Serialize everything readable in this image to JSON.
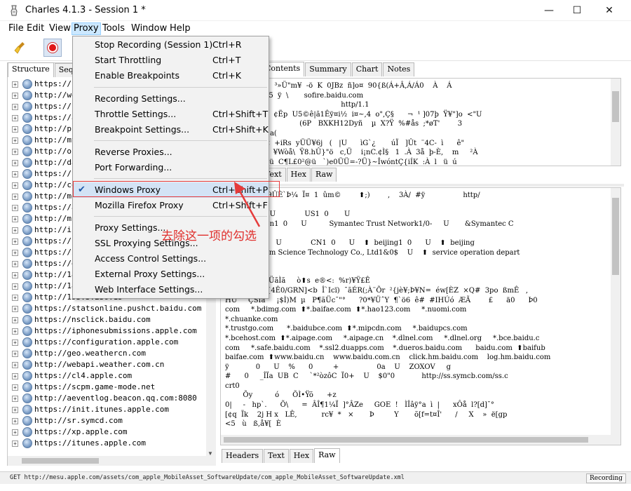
{
  "window": {
    "title": "Charles 4.1.3 - Session 1 *",
    "minimize_glyph": "—",
    "maximize_glyph": "☐",
    "close_glyph": "✕"
  },
  "menubar": [
    "File",
    "Edit",
    "View",
    "Proxy",
    "Tools",
    "Window",
    "Help"
  ],
  "toolbar": {
    "icons": [
      "broom-icon",
      "record-icon"
    ]
  },
  "left_panel": {
    "tabs": [
      "Structure",
      "Seq"
    ],
    "hosts": [
      "https://s",
      "http://we",
      "https://u",
      "https://a",
      "http://pu",
      "http://mt",
      "http://on",
      "http://da",
      "https://s",
      "http://co",
      "http://mo",
      "https://a",
      "http://m.",
      "http://if",
      "https://c",
      "https://i",
      "https://g",
      "http://18",
      "http://185.map.baidu.com",
      "http://153.3.236.15",
      "https://statsonline.pushct.baidu.com",
      "https://nsclick.baidu.com",
      "https://iphonesubmissions.apple.com",
      "https://configuration.apple.com",
      "http://geo.weathercn.com",
      "http://webapi.weather.com.cn",
      "https://cl4.apple.com",
      "https://scpm.game-mode.net",
      "http://aeventlog.beacon.qq.com:8080",
      "https://init.itunes.apple.com",
      "http://sr.symcd.com",
      "https://xp.apple.com",
      "https://itunes.apple.com"
    ]
  },
  "right_panel": {
    "top_tabs": [
      "Contents",
      "Summary",
      "Chart",
      "Notes"
    ],
    "top_subtabs": [
      "Text",
      "Hex",
      "Raw"
    ],
    "top_lines": [
      "  ±   -    yz¤    ³»Ü\"m¥  -ö  K  0JBz  ñ]o¤  90{ß(Á+Â,Á/Á0    À    Á",
      "  39Â  À      /5  ÿ  \\       sofire.baidu.com",
      "                                                    http/1.1",
      "        F  BA     ¢Ëp  U5©ê|ã1Êÿ¤i½  i¤~,4  o\",Ç§      ¬  ¹ ]07þ  Ÿ¥\"]o  <\"U",
      "ü0ÜA0Ï I:                  (6P   BXKH12Dyñ    µ  X?Ÿ  %#ås  ;*øT'        3",
      "    R0    AtÂ2a(",
      "N   o   Â%jÏ¤  +iRs  yÜÜ¥6j   (   |U      ìG`¿       úÏ   ]Ût  ¨4C-  ì      ê\"",
      "  ¥6@  cKe`   ¥Wòå\\  Ÿ8.hÛ}\"ö   c,Ü    i¡nC.¢Ì§   1  .À  3å  þ-È,    m     ²À",
      "+ ßÉ '          ü  C¶L£0²@ü   `)e0ÜÜ=-?Ü}~ÎwóntÇ{iÍK  :À  l   ü  ú"
    ],
    "bottom_lines": [
      "  Yf÷ö%«  È9ÛÈ`Þ¼  Ï¤  1  ûm©        ⬆;)        ,    3À/  #ÿ                 http/",
      "  *  H  ÷",
      "    0              U             US1  0       U",
      "c Corporation1  0      U          Symantec Trust Network1/0-     U       &Symantec C",
      "0Z",
      "9Z0  ¨1  0       U             CN1  0      U    ⬆  beijing1  0      U    ⬆  beijing",
      "Baidu Netcom Science Technology Co., Ltd1&0$    U    ⬆  service operation depart",
      " *  H  ÷",
      "    0",
      "    Bþ¿¢0²  XÜãÌã     ò⬆s  e®<:  %r)¥Ÿ£Ê",
      "  ûåuq{Ñà  {4Ê0/GRN]<b  Î`Icï)  ¯ãÉR(;À¨Õr  ²{jè¥;Þ¥N=  éw[ÈZ  ×Q#  3po  ßmÊ   ,",
      "HÜ     ÇSÎâ     ¡$Ì)M  µ   P¶ãÜc¯\"°      ?0*¥ÜˆY  ¶`ö6  ê#  #IHÚó  ÆÃ        £      ä0      Þ0",
      "com     *.bdimg.com  ⬆*.baifae.com  ⬆*.hao123.com     *.nuomi.com",
      "*.chuanke.com",
      "*.trustgo.com      *.baidubce.com  ⬆*.mipcdn.com     *.baidupcs.com",
      "*.bcehost.com  ⬆*.aipage.com     *.aipage.cn    *.dlnel.com     *.dlnel.org     *.bce.baidu.c",
      "com     *.safe.baidu.com    *.ssl2.duapps.com    *.dueros.baidu.com      baidu.com  ⬆baifub",
      "baifae.com  ⬆www.baidu.cn    www.baidu.com.cn    click.hm.baidu.com    log.hm.baidu.com",
      "ÿ            0      U    %      0         +                 0a    U    ZOXOV     g",
      "#      0     _ÎÏa  UB  C     `*²òzôC  Ï0+    U    $0\"0            http://ss.symcb.com/ss.c",
      "crt0",
      "        Õy          ó      ÕÌ•Ÿõ      +z",
      "0|     -   hp`.      Õ\\      =  ÂÎ¶1¼Ï  ]°ÂZe     GOE  !   ÌÎâÿ°a  ì  |      xÔå  l?[d]¯°",
      "[¢q  Ïk    2j H x   LÊ,           rc¥  *   ×       Þ         Y       õ[f=t¤Î'      /     X    »  ë[gp",
      "<5   ù   ß,å¥[  È"
    ],
    "bottom_subtabs": [
      "Headers",
      "Text",
      "Hex",
      "Raw"
    ]
  },
  "proxy_menu": {
    "items": [
      {
        "label": "Stop Recording (Session 1)",
        "shortcut": "Ctrl+R"
      },
      {
        "label": "Start Throttling",
        "shortcut": "Ctrl+T"
      },
      {
        "label": "Enable Breakpoints",
        "shortcut": "Ctrl+K"
      },
      {
        "label": "Recording Settings...",
        "shortcut": ""
      },
      {
        "label": "Throttle Settings...",
        "shortcut": "Ctrl+Shift+T"
      },
      {
        "label": "Breakpoint Settings...",
        "shortcut": "Ctrl+Shift+K"
      },
      {
        "label": "Reverse Proxies...",
        "shortcut": ""
      },
      {
        "label": "Port Forwarding...",
        "shortcut": ""
      },
      {
        "label": "Windows Proxy",
        "shortcut": "Ctrl+Shift+P",
        "checked": true
      },
      {
        "label": "Mozilla Firefox Proxy",
        "shortcut": "Ctrl+Shift+F"
      },
      {
        "label": "Proxy Settings...",
        "shortcut": ""
      },
      {
        "label": "SSL Proxying Settings...",
        "shortcut": ""
      },
      {
        "label": "Access Control Settings...",
        "shortcut": ""
      },
      {
        "label": "External Proxy Settings...",
        "shortcut": ""
      },
      {
        "label": "Web Interface Settings...",
        "shortcut": ""
      }
    ],
    "check_glyph": "✔"
  },
  "annotation": {
    "text": "去除这一项的勾选",
    "color": "#e0302d"
  },
  "statusbar": {
    "text": "GET http://mesu.apple.com/assets/com_apple_MobileAsset_SoftwareUpdate/com_apple_MobileAsset_SoftwareUpdate.xml",
    "badge": "Recording"
  },
  "colors": {
    "menu_highlight": "#d3e3f5",
    "open_menu": "#cce8ff",
    "record": "#e01818"
  }
}
